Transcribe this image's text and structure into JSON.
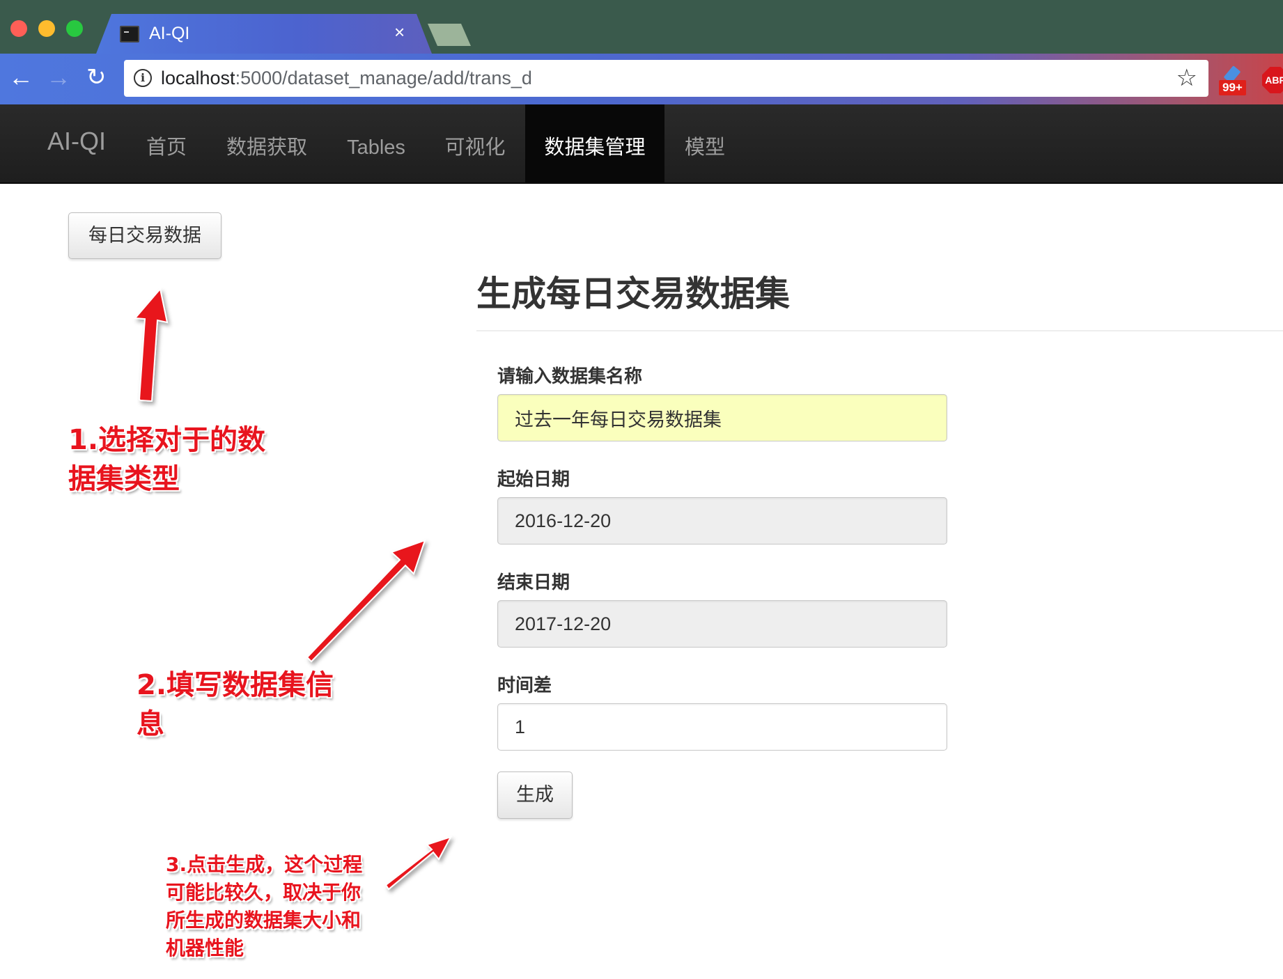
{
  "browser": {
    "tab_title": "AI-QI",
    "tab_close": "×",
    "url_host": "localhost",
    "url_path": ":5000/dataset_manage/add/trans_d",
    "extension_badge": "99+",
    "abp_label": "ABP",
    "icons": [
      "back-arrow-icon",
      "forward-arrow-icon",
      "reload-icon",
      "info-icon",
      "star-icon",
      "terminal-favicon-icon"
    ]
  },
  "navbar": {
    "brand": "AI-QI",
    "items": [
      {
        "label": "首页"
      },
      {
        "label": "数据获取"
      },
      {
        "label": "Tables"
      },
      {
        "label": "可视化"
      },
      {
        "label": "数据集管理",
        "active": true
      },
      {
        "label": "模型"
      }
    ]
  },
  "sidebar": {
    "dataset_type_button": "每日交易数据"
  },
  "form": {
    "title": "生成每日交易数据集",
    "name_label": "请输入数据集名称",
    "name_value": "过去一年每日交易数据集",
    "start_label": "起始日期",
    "start_value": "2016-12-20",
    "end_label": "结束日期",
    "end_value": "2017-12-20",
    "lag_label": "时间差",
    "lag_value": "1",
    "submit_label": "生成"
  },
  "annotations": {
    "step1_line1": "1.选择对于的数",
    "step1_line2": "据集类型",
    "step2_line1": "2.填写数据集信",
    "step2_line2": "息",
    "step3_line1": "3.点击生成，这个过程",
    "step3_line2": "可能比较久，取决于你",
    "step3_line3": "所生成的数据集大小和",
    "step3_line4": "机器性能",
    "color": "#e8141e"
  },
  "colors": {
    "titlebar": "#3a5a4c",
    "navbar": "#222222",
    "nav_active": "#080808",
    "autofill": "#faffbd",
    "readonly": "#eeeeee"
  }
}
